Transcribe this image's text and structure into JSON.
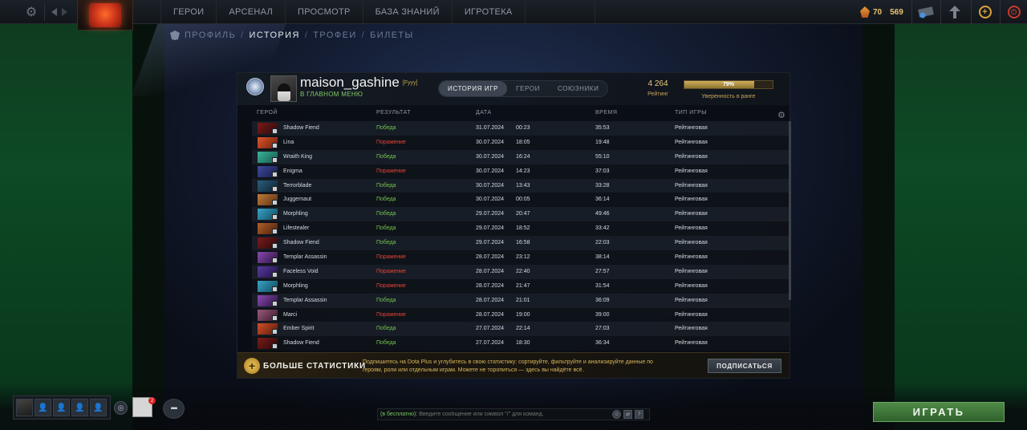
{
  "topbar": {
    "nav": [
      "ГЕРОИ",
      "АРСЕНАЛ",
      "ПРОСМОТР",
      "БАЗА ЗНАНИЙ",
      "ИГРОТЕКА"
    ],
    "currency_shards": "70",
    "currency_gold": "569"
  },
  "subnav": {
    "items": [
      "ПРОФИЛЬ",
      "ИСТОРИЯ",
      "ТРОФЕИ",
      "БИЛЕТЫ"
    ],
    "separator": "/"
  },
  "profile": {
    "name": "maison_gashine",
    "tag": "[Fyyy]",
    "status": "В ГЛАВНОМ МЕНЮ",
    "tabs": [
      "ИСТОРИЯ ИГР",
      "ГЕРОИ",
      "СОЮЗНИКИ"
    ],
    "rating_value": "4 264",
    "rating_label": "Рейтинг",
    "confidence_percent": 79,
    "confidence_text": "79%",
    "confidence_label": "Уверенность в ранге"
  },
  "table": {
    "headers": [
      "ГЕРОЙ",
      "РЕЗУЛЬТАТ",
      "ДАТА",
      "ВРЕМЯ",
      "ТИП ИГРЫ"
    ],
    "rows": [
      {
        "hero": "Shadow Fiend",
        "result": "Победа",
        "win": true,
        "date": "31.07.2024",
        "time": "00:23",
        "duration": "35:53",
        "type": "Рейтинговая",
        "c1": "#7a1a1a",
        "c2": "#2a0a0a"
      },
      {
        "hero": "Lina",
        "result": "Поражение",
        "win": false,
        "date": "30.07.2024",
        "time": "18:05",
        "duration": "19:48",
        "type": "Рейтинговая",
        "c1": "#e0552a",
        "c2": "#6a1f10"
      },
      {
        "hero": "Wraith King",
        "result": "Победа",
        "win": true,
        "date": "30.07.2024",
        "time": "16:24",
        "duration": "55:10",
        "type": "Рейтинговая",
        "c1": "#3bb39a",
        "c2": "#145a4a"
      },
      {
        "hero": "Enigma",
        "result": "Поражение",
        "win": false,
        "date": "30.07.2024",
        "time": "14:23",
        "duration": "37:03",
        "type": "Рейтинговая",
        "c1": "#3e4aa0",
        "c2": "#161a44"
      },
      {
        "hero": "Terrorblade",
        "result": "Победа",
        "win": true,
        "date": "30.07.2024",
        "time": "13:43",
        "duration": "33:28",
        "type": "Рейтинговая",
        "c1": "#2b5e7c",
        "c2": "#0d2231"
      },
      {
        "hero": "Juggernaut",
        "result": "Победа",
        "win": true,
        "date": "30.07.2024",
        "time": "00:05",
        "duration": "36:14",
        "type": "Рейтинговая",
        "c1": "#c07a3a",
        "c2": "#5a2f12"
      },
      {
        "hero": "Morphling",
        "result": "Победа",
        "win": true,
        "date": "29.07.2024",
        "time": "20:47",
        "duration": "49:46",
        "type": "Рейтинговая",
        "c1": "#3aa3c8",
        "c2": "#0f4a5c"
      },
      {
        "hero": "Lifestealer",
        "result": "Победа",
        "win": true,
        "date": "29.07.2024",
        "time": "18:52",
        "duration": "33:42",
        "type": "Рейтинговая",
        "c1": "#b0602a",
        "c2": "#4a1f0d"
      },
      {
        "hero": "Shadow Fiend",
        "result": "Победа",
        "win": true,
        "date": "29.07.2024",
        "time": "16:58",
        "duration": "22:03",
        "type": "Рейтинговая",
        "c1": "#7a1a1a",
        "c2": "#2a0a0a"
      },
      {
        "hero": "Templar Assassin",
        "result": "Поражение",
        "win": false,
        "date": "28.07.2024",
        "time": "23:12",
        "duration": "38:14",
        "type": "Рейтинговая",
        "c1": "#8a4ab0",
        "c2": "#2c1240"
      },
      {
        "hero": "Faceless Void",
        "result": "Поражение",
        "win": false,
        "date": "28.07.2024",
        "time": "22:40",
        "duration": "27:57",
        "type": "Рейтинговая",
        "c1": "#5a3aa0",
        "c2": "#1d1240"
      },
      {
        "hero": "Morphling",
        "result": "Поражение",
        "win": false,
        "date": "28.07.2024",
        "time": "21:47",
        "duration": "31:54",
        "type": "Рейтинговая",
        "c1": "#3aa3c8",
        "c2": "#0f4a5c"
      },
      {
        "hero": "Templar Assassin",
        "result": "Победа",
        "win": true,
        "date": "28.07.2024",
        "time": "21:01",
        "duration": "36:09",
        "type": "Рейтинговая",
        "c1": "#8a4ab0",
        "c2": "#2c1240"
      },
      {
        "hero": "Marci",
        "result": "Поражение",
        "win": false,
        "date": "28.07.2024",
        "time": "19:00",
        "duration": "39:00",
        "type": "Рейтинговая",
        "c1": "#9a5a7a",
        "c2": "#3a1a2a"
      },
      {
        "hero": "Ember Spirit",
        "result": "Победа",
        "win": true,
        "date": "27.07.2024",
        "time": "22:14",
        "duration": "27:03",
        "type": "Рейтинговая",
        "c1": "#d0502a",
        "c2": "#5a1a0a"
      },
      {
        "hero": "Shadow Fiend",
        "result": "Победа",
        "win": true,
        "date": "27.07.2024",
        "time": "18:30",
        "duration": "36:34",
        "type": "Рейтинговая",
        "c1": "#7a1a1a",
        "c2": "#2a0a0a"
      }
    ]
  },
  "promo": {
    "title": "БОЛЬШЕ СТАТИСТИКИ",
    "text": "Подпишитесь на Dota Plus и углубитесь в свою статистику: сортируйте, фильтруйте и анализируйте данные по героям, роли или отдельным играм. Можете не торопиться — здесь вы найдёте всё.",
    "button": "ПОДПИСАТЬСЯ"
  },
  "bottom": {
    "chat_channel": "(в бесплатно):",
    "chat_placeholder": "Введите сообщение или символ \"/\" для команд.",
    "friends_badge": "2",
    "help_icon": "?",
    "play_button": "ИГРАТЬ"
  },
  "colors": {
    "win": "#74c34f",
    "loss": "#e0453a",
    "accent_gold": "#e7c77b",
    "play_green": "#3f7a39"
  }
}
